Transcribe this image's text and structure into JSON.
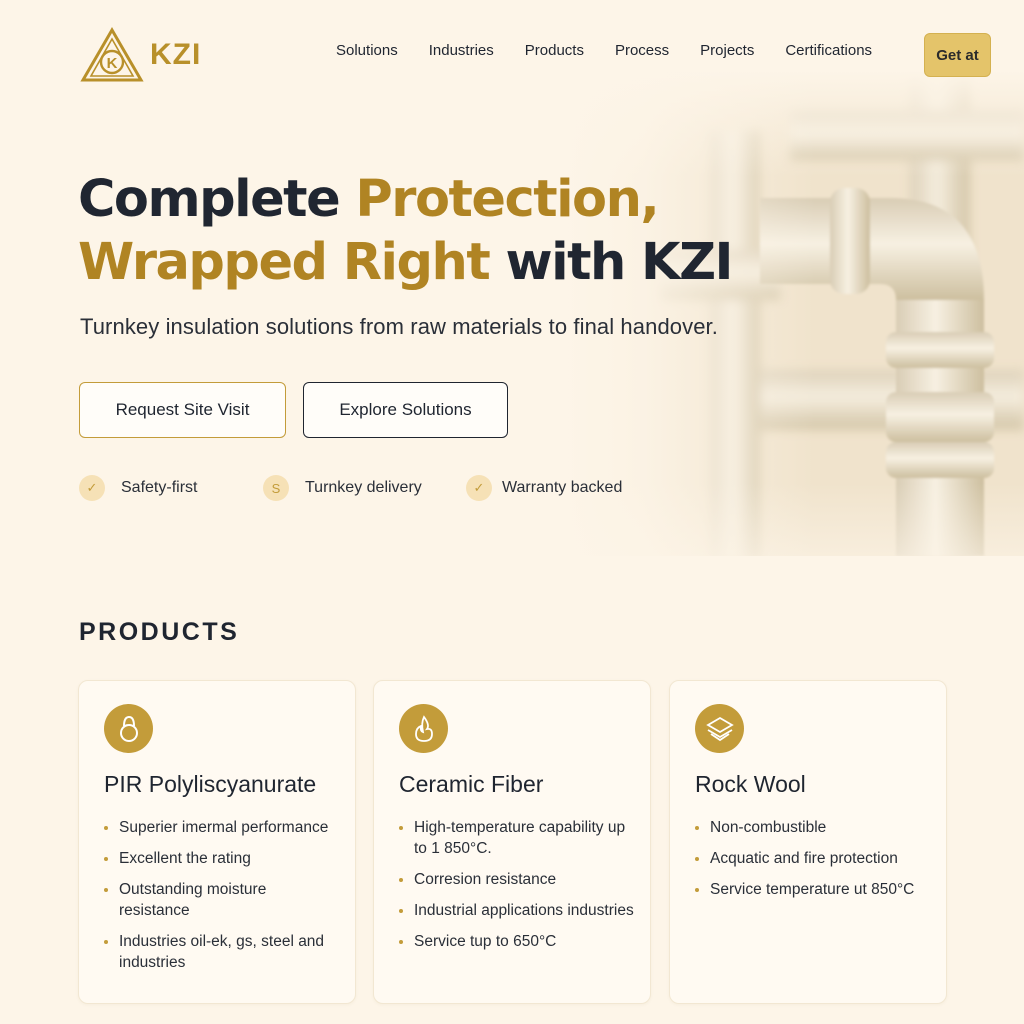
{
  "brand": {
    "name": "KZI",
    "logo_letter": "K",
    "accent": "#b08423"
  },
  "nav": {
    "links": [
      "Solutions",
      "Industries",
      "Products",
      "Process",
      "Projects",
      "Certifications"
    ],
    "cta_label": "Get at"
  },
  "hero": {
    "title_line1_dark": "Complete ",
    "title_line1_gold": "Protection,",
    "title_line2_gold": "Wrapped Right",
    "title_line2_dark": " with KZI",
    "subtitle": "Turnkey insulation solutions from raw materials to final handover.",
    "primary_button": "Request Site Visit",
    "secondary_button": "Explore Solutions",
    "badges": [
      {
        "icon": "check-icon",
        "glyph": "✓",
        "label": "Safety-first"
      },
      {
        "icon": "dollar-icon",
        "glyph": "S",
        "label": "Turnkey delivery"
      },
      {
        "icon": "check-icon",
        "glyph": "✓",
        "label": "Warranty backed"
      }
    ]
  },
  "products": {
    "heading": "PRODUCTS",
    "cards": [
      {
        "icon": "ring-icon",
        "title": "PIR Polyliscyanurate",
        "bullets": [
          "Superier imermal performance",
          "Excellent the rating",
          "Outstanding moisture resistance",
          "Industries oil-ek, gs, steel and industries"
        ]
      },
      {
        "icon": "flame-icon",
        "title": "Ceramic Fiber",
        "bullets": [
          "High-temperature capability up to 1 850°C.",
          "Corresion resistance",
          "Industrial applications industries",
          "Service tup to 650°C"
        ]
      },
      {
        "icon": "layers-icon",
        "title": "Rock Wool",
        "bullets": [
          "Non-combustible",
          "Acquatic and fire protection",
          "Service temperature ut 850°C"
        ]
      }
    ]
  }
}
